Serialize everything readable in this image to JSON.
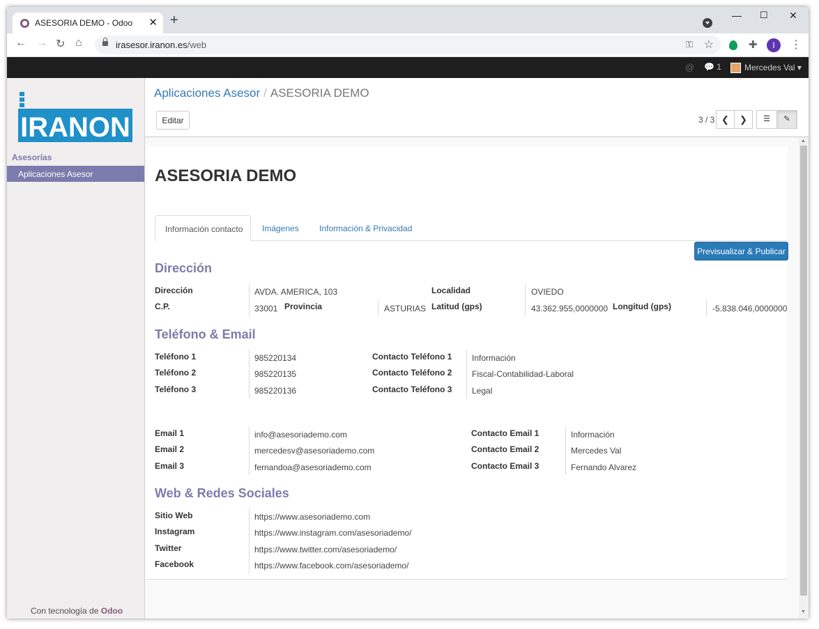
{
  "browser": {
    "tab_title": "ASESORIA DEMO - Odoo",
    "url_host": "irasesor.iranon.es",
    "url_path": "/web"
  },
  "topbar": {
    "chat_count": "1",
    "user_name": "Mercedes Val"
  },
  "sidebar": {
    "logo_text": "IRANON",
    "section": "Asesorías",
    "item": "Aplicaciones Asesor",
    "powered_prefix": "Con tecnología de",
    "powered_brand": "Odoo"
  },
  "control_panel": {
    "breadcrumb_parent": "Aplicaciones Asesor",
    "breadcrumb_current": "ASESORIA DEMO",
    "edit_label": "Editar",
    "pager": "3 / 3"
  },
  "form": {
    "title": "ASESORIA DEMO",
    "tabs": [
      "Información contacto",
      "Imágenes",
      "Información & Privacidad"
    ],
    "publish_label": "Previsualizar & Publicar",
    "address": {
      "section": "Dirección",
      "direccion_label": "Dirección",
      "direccion": "AVDA. AMERICA, 103",
      "localidad_label": "Localidad",
      "localidad": "OVIEDO",
      "cp_label": "C.P.",
      "cp": "33001",
      "provincia_label": "Provincia",
      "provincia": "ASTURIAS",
      "latitud_label": "Latitud (gps)",
      "latitud": "43.362.955,0000000",
      "longitud_label": "Longitud (gps)",
      "longitud": "-5.838.046,0000000"
    },
    "phone": {
      "section": "Teléfono & Email",
      "rows": [
        {
          "label": "Teléfono 1",
          "value": "985220134",
          "contact_label": "Contacto Teléfono 1",
          "contact": "Información"
        },
        {
          "label": "Teléfono 2",
          "value": "985220135",
          "contact_label": "Contacto Teléfono 2",
          "contact": "Fiscal-Contabilidad-Laboral"
        },
        {
          "label": "Teléfono 3",
          "value": "985220136",
          "contact_label": "Contacto Teléfono 3",
          "contact": "Legal"
        }
      ]
    },
    "email": {
      "rows": [
        {
          "label": "Email 1",
          "value": "info@asesoriademo.com",
          "contact_label": "Contacto Email 1",
          "contact": "Información"
        },
        {
          "label": "Email 2",
          "value": "mercedesv@asesoriademo.com",
          "contact_label": "Contacto Email 2",
          "contact": "Mercedes Val"
        },
        {
          "label": "Email 3",
          "value": "fernandoa@asesoriademo.com",
          "contact_label": "Contacto Email 3",
          "contact": "Fernando Alvarez"
        }
      ]
    },
    "web": {
      "section": "Web & Redes Sociales",
      "rows": [
        {
          "label": "Sitio Web",
          "value": "https://www.asesoriademo.com"
        },
        {
          "label": "Instagram",
          "value": "https://www.instagram.com/asesoriademo/"
        },
        {
          "label": "Twitter",
          "value": "https://www.twitter.com/asesoriademo/"
        },
        {
          "label": "Facebook",
          "value": "https://www.facebook.com/asesoriademo/"
        }
      ]
    }
  },
  "colors": {
    "accent": "#7c7bad",
    "primary_button": "#2a7ab7",
    "link": "#337ab7",
    "brand_logo": "#1f90c8"
  }
}
